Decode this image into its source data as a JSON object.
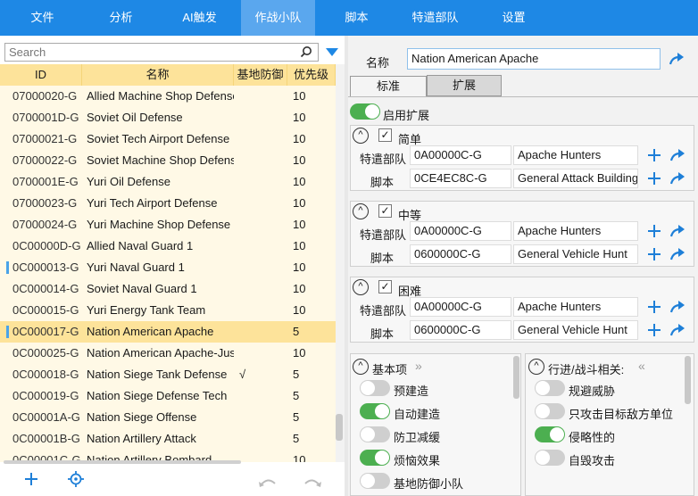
{
  "tabs": [
    "文件",
    "分析",
    "AI触发",
    "作战小队",
    "脚本",
    "特遣部队",
    "设置"
  ],
  "active_tab": 3,
  "search": {
    "placeholder": "Search"
  },
  "table": {
    "headers": [
      "ID",
      "名称",
      "基地防御",
      "优先级"
    ],
    "rows": [
      {
        "id": "07000020-G",
        "name": "Allied Machine Shop Defense",
        "def": "",
        "pri": "10"
      },
      {
        "id": "0700001D-G",
        "name": "Soviet Oil Defense",
        "def": "",
        "pri": "10"
      },
      {
        "id": "07000021-G",
        "name": "Soviet Tech Airport Defense",
        "def": "",
        "pri": "10"
      },
      {
        "id": "07000022-G",
        "name": "Soviet Machine Shop Defense",
        "def": "",
        "pri": "10"
      },
      {
        "id": "0700001E-G",
        "name": "Yuri Oil Defense",
        "def": "",
        "pri": "10"
      },
      {
        "id": "07000023-G",
        "name": "Yuri Tech Airport Defense",
        "def": "",
        "pri": "10"
      },
      {
        "id": "07000024-G",
        "name": "Yuri Machine Shop Defense",
        "def": "",
        "pri": "10"
      },
      {
        "id": "0C00000D-G",
        "name": "Allied Naval Guard 1",
        "def": "",
        "pri": "10"
      },
      {
        "id": "0C000013-G",
        "name": "Yuri Naval Guard 1",
        "def": "",
        "pri": "10"
      },
      {
        "id": "0C000014-G",
        "name": "Soviet Naval Guard 1",
        "def": "",
        "pri": "10"
      },
      {
        "id": "0C000015-G",
        "name": "Yuri Energy Tank Team",
        "def": "",
        "pri": "10"
      },
      {
        "id": "0C000017-G",
        "name": "Nation American Apache",
        "def": "",
        "pri": "5"
      },
      {
        "id": "0C000025-G",
        "name": "Nation American Apache-Just",
        "def": "",
        "pri": "10"
      },
      {
        "id": "0C000018-G",
        "name": "Nation Siege Tank Defense",
        "def": "√",
        "pri": "5"
      },
      {
        "id": "0C000019-G",
        "name": "Nation Siege Defense Tech",
        "def": "",
        "pri": "5"
      },
      {
        "id": "0C00001A-G",
        "name": "Nation Siege Offense",
        "def": "",
        "pri": "5"
      },
      {
        "id": "0C00001B-G",
        "name": "Nation Artillery Attack",
        "def": "",
        "pri": "5"
      },
      {
        "id": "0C00001C-G",
        "name": "Nation Artillery Bombard",
        "def": "",
        "pri": "10"
      }
    ],
    "selected_row": 11,
    "marked_rows": [
      8,
      11
    ]
  },
  "detail": {
    "name_label": "名称",
    "name_value": "Nation American Apache",
    "subtabs": [
      "标准",
      "扩展"
    ],
    "active_subtab": 1,
    "enable_ext_label": "启用扩展",
    "enable_ext_on": true,
    "groups": [
      {
        "title": "简单",
        "checked": true,
        "taskforce_label": "特遣部队",
        "taskforce_id": "0A00000C-G",
        "taskforce_name": "Apache Hunters",
        "script_label": "脚本",
        "script_id": "0CE4EC8C-G",
        "script_name": "General Attack Buildings"
      },
      {
        "title": "中等",
        "checked": true,
        "taskforce_label": "特遣部队",
        "taskforce_id": "0A00000C-G",
        "taskforce_name": "Apache Hunters",
        "script_label": "脚本",
        "script_id": "0600000C-G",
        "script_name": "General Vehicle Hunt"
      },
      {
        "title": "困难",
        "checked": true,
        "taskforce_label": "特遣部队",
        "taskforce_id": "0A00000C-G",
        "taskforce_name": "Apache Hunters",
        "script_label": "脚本",
        "script_id": "0600000C-G",
        "script_name": "General Vehicle Hunt"
      }
    ],
    "basic_panel": {
      "title": "基本项",
      "items": [
        {
          "label": "预建造",
          "on": false
        },
        {
          "label": "自动建造",
          "on": true
        },
        {
          "label": "防卫减缓",
          "on": false
        },
        {
          "label": "烦恼效果",
          "on": true
        },
        {
          "label": "基地防御小队",
          "on": false
        }
      ]
    },
    "combat_panel": {
      "title": "行进/战斗相关:",
      "items": [
        {
          "label": "规避威胁",
          "on": false
        },
        {
          "label": "只攻击目标敌方单位",
          "on": false
        },
        {
          "label": "侵略性的",
          "on": true
        },
        {
          "label": "自毁攻击",
          "on": false
        }
      ]
    }
  },
  "colors": {
    "accent": "#1e88e5",
    "selected_row": "#fde39a",
    "row_bg": "#fff9e6",
    "toggle_on": "#4caf50",
    "icon_blue": "#1e7fd8"
  }
}
